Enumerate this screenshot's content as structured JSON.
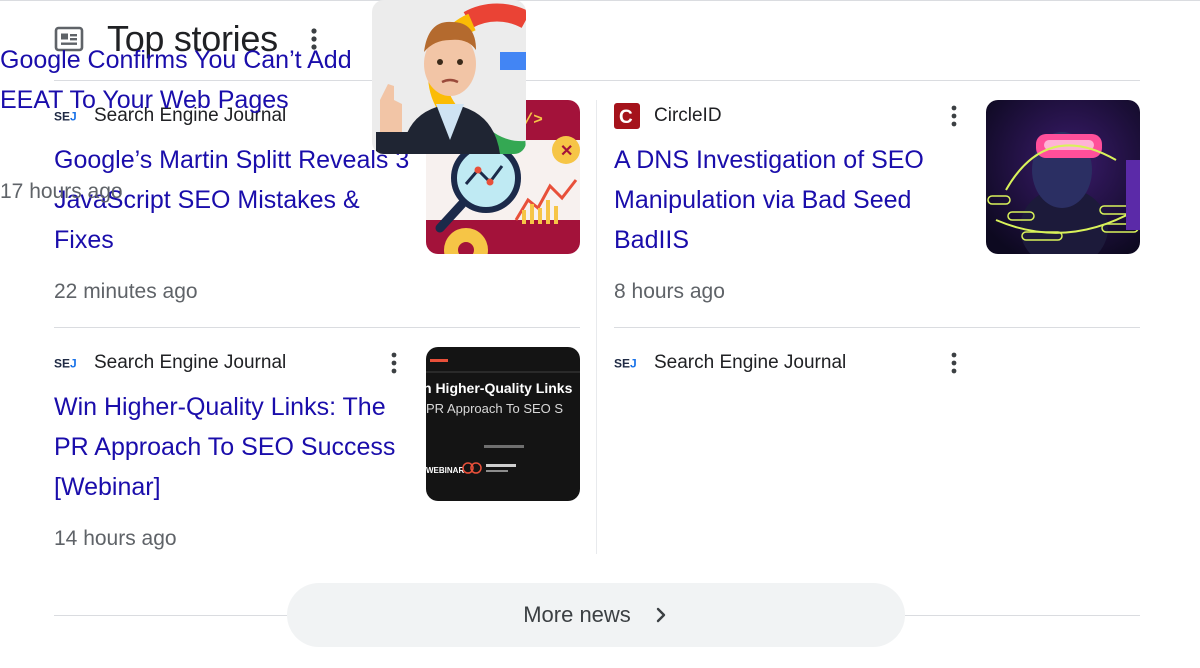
{
  "section": {
    "title": "Top stories"
  },
  "stories": [
    {
      "source": "Search Engine Journal",
      "source_logo": "SEJ",
      "headline": "Google’s Martin Splitt Reveals 3 JavaScript SEO Mistakes & Fixes",
      "time": "22 minutes ago",
      "thumbnail": {
        "code_tag": "</>"
      }
    },
    {
      "source": "CircleID",
      "source_logo": "C",
      "headline": "A DNS Investigation of SEO Manipulation via Bad Seed BadIIS",
      "time": "8 hours ago",
      "thumbnail": {}
    },
    {
      "source": "Search Engine Journal",
      "source_logo": "SEJ",
      "headline": "Win Higher-Quality Links: The PR Approach To SEO Success [Webinar]",
      "time": "14 hours ago",
      "thumbnail": {
        "line1": "h Higher-Quality Links",
        "line2": "PR Approach To SEO S",
        "tag": "WEBINAR"
      }
    },
    {
      "source": "Search Engine Journal",
      "source_logo": "SEJ",
      "headline": "Google Confirms You Can’t Add EEAT To Your Web Pages",
      "time": "17 hours ago",
      "thumbnail": {}
    }
  ],
  "more_news": {
    "label": "More news"
  },
  "colors": {
    "link": "#1a0dab",
    "meta": "#5f6368",
    "divider": "#dadce0",
    "button_bg": "#f1f3f4",
    "circleid_red": "#a5131b"
  },
  "icons": {
    "header": "news-icon",
    "menu": "more-vert-icon",
    "chevron": "chevron-right-icon"
  }
}
